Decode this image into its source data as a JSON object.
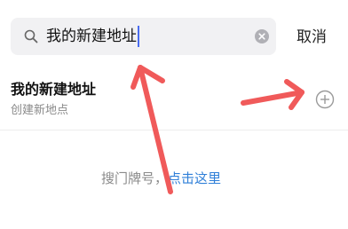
{
  "search": {
    "value": "我的新建地址",
    "icon": "search-icon",
    "clear_icon": "clear-icon"
  },
  "cancel_label": "取消",
  "result": {
    "title": "我的新建地址",
    "subtitle": "创建新地点",
    "action_icon": "add-circle-icon"
  },
  "hint": {
    "text": "搜门牌号，",
    "link": "点击这里"
  },
  "colors": {
    "link": "#2f7fd8",
    "annotation_arrow": "#f05a5a",
    "caret": "#4a6cf0"
  }
}
